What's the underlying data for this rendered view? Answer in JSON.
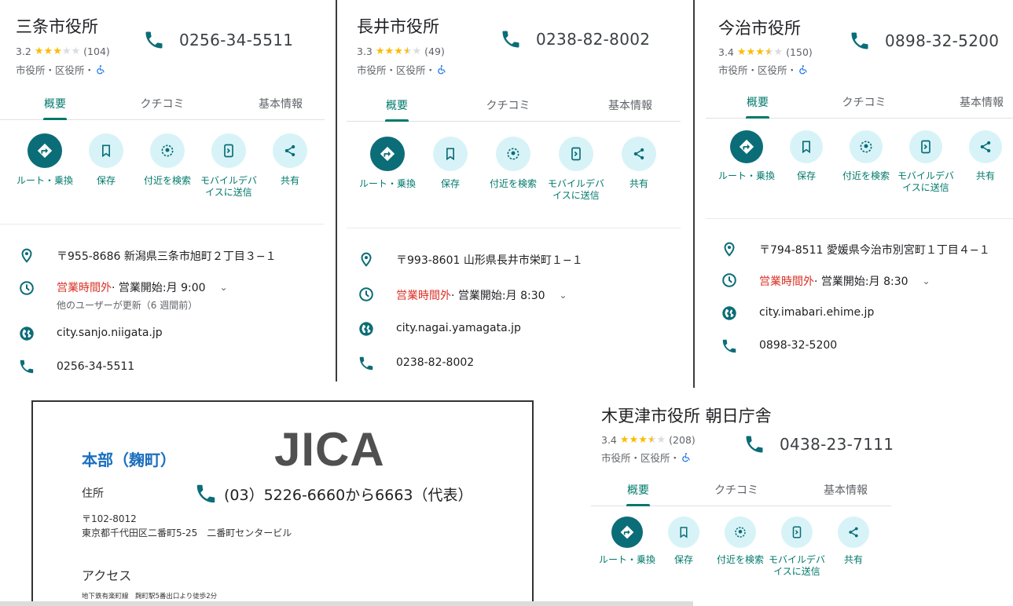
{
  "colors": {
    "accent": "#00796b",
    "accent_dark": "#0b6d77",
    "action_bg": "#d7f3f7",
    "closed": "#d93025",
    "star": "#fbbc04",
    "jica_title": "#1a6fbf"
  },
  "icons": [
    "phone-icon",
    "directions-icon",
    "bookmark-icon",
    "nearby-icon",
    "send-to-device-icon",
    "share-icon",
    "location-pin-icon",
    "clock-icon",
    "globe-icon",
    "wheelchair-icon",
    "chevron-down-icon"
  ],
  "common": {
    "tabs": [
      "概要",
      "クチコミ",
      "基本情報"
    ],
    "actions": [
      "ルート・乗換",
      "保存",
      "付近を検索",
      "モバイルデバイスに送信",
      "共有"
    ],
    "category": "市役所・区役所・",
    "hours_closed": "営業時間外",
    "hours_sep": " · 営業開始: "
  },
  "panels": {
    "sanjo": {
      "name": "三条市役所",
      "rating": "3.2",
      "stars": 3.0,
      "reviews": "(104)",
      "phone": "0256-34-5511",
      "address": "〒955-8686 新潟県三条市旭町２丁目３−１",
      "opens": "月 9:00",
      "updated": "他のユーザーが更新（6 週間前）",
      "website": "city.sanjo.niigata.jp"
    },
    "nagai": {
      "name": "長井市役所",
      "rating": "3.3",
      "stars": 3.5,
      "reviews": "(49)",
      "phone": "0238-82-8002",
      "address": "〒993-8601 山形県長井市栄町１−１",
      "opens": "月 8:30",
      "website": "city.nagai.yamagata.jp"
    },
    "imabari": {
      "name": "今治市役所",
      "rating": "3.4",
      "stars": 3.5,
      "reviews": "(150)",
      "phone": "0898-32-5200",
      "address": "〒794-8511 愛媛県今治市別宮町１丁目４−１",
      "opens": "月 8:30",
      "website": "city.imabari.ehime.jp"
    },
    "kisarazu": {
      "name": "木更津市役所 朝日庁舎",
      "rating": "3.4",
      "stars": 3.5,
      "reviews": "(208)",
      "phone": "0438-23-7111"
    }
  },
  "jica": {
    "title": "本部（麹町）",
    "logo": "JICA",
    "address_heading": "住所",
    "phone": "(03）5226-6660から6663（代表）",
    "zip": "〒102-8012",
    "address": "東京都千代田区二番町5-25　二番町センタービル",
    "access_heading": "アクセス",
    "access": "地下鉄有楽町線　麹町駅5番出口より徒歩2分"
  }
}
